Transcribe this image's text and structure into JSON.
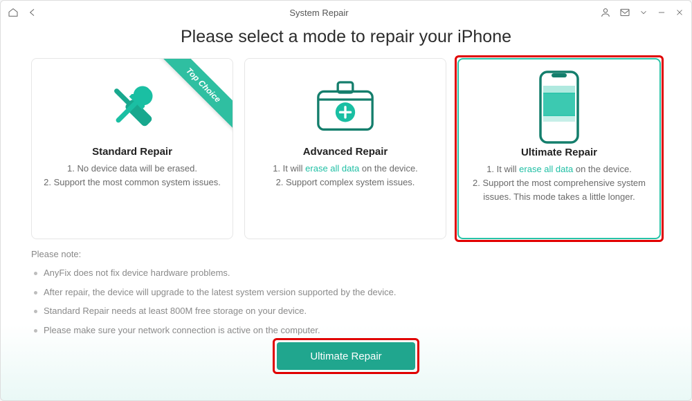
{
  "titlebar": {
    "title": "System Repair"
  },
  "headline": "Please select a mode to repair your iPhone",
  "cards": {
    "standard": {
      "ribbon": "Top Choice",
      "title": "Standard Repair",
      "line1": "1. No device data will be erased.",
      "line2": "2. Support the most common system issues."
    },
    "advanced": {
      "title": "Advanced Repair",
      "line1_prefix": "1. It will ",
      "line1_em": "erase all data",
      "line1_suffix": " on the device.",
      "line2": "2. Support complex system issues."
    },
    "ultimate": {
      "title": "Ultimate Repair",
      "line1_prefix": "1. It will ",
      "line1_em": "erase all data",
      "line1_suffix": " on the device.",
      "line2": "2. Support the most comprehensive system issues. This mode takes a little longer."
    }
  },
  "notes": {
    "title": "Please note:",
    "items": [
      "AnyFix does not fix device hardware problems.",
      "After repair, the device will upgrade to the latest system version supported by the device.",
      "Standard Repair needs at least 800M free storage on your device.",
      "Please make sure your network connection is active on the computer."
    ]
  },
  "primary_button": "Ultimate Repair",
  "colors": {
    "accent": "#20a68e"
  }
}
